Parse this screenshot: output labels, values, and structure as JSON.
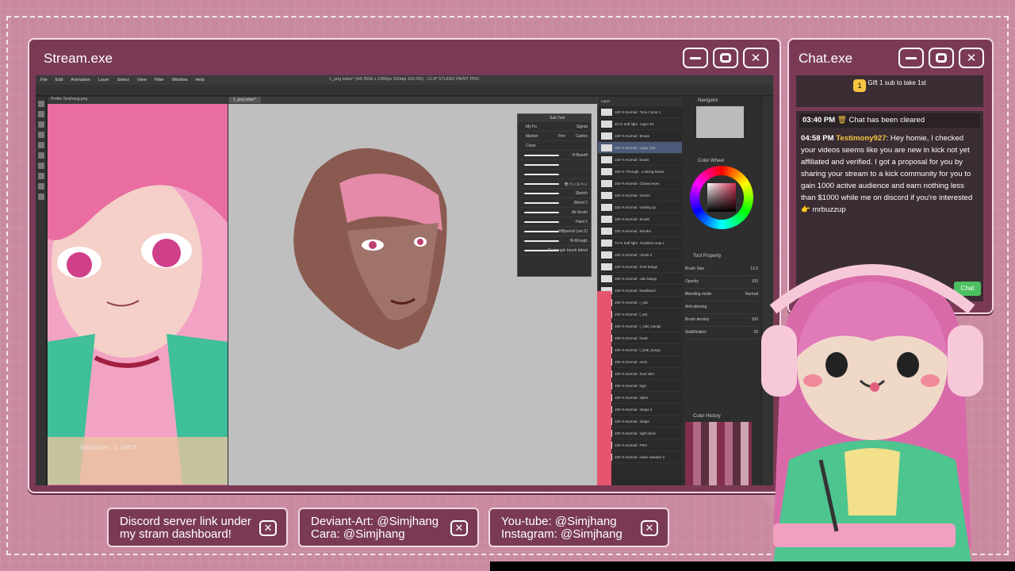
{
  "stream_window": {
    "title": "Stream.exe",
    "buttons": [
      "minimize",
      "maximize",
      "close"
    ]
  },
  "chat_window": {
    "title": "Chat.exe",
    "buttons": [
      "minimize",
      "maximize",
      "close"
    ]
  },
  "app": {
    "title": "1_png tuber* (A4 3508 x 2480px 300dpi 150.0%) - CLIP STUDIO PAINT PRO",
    "menu": [
      "File",
      "Edit",
      "Animation",
      "Layer",
      "Select",
      "View",
      "Filter",
      "Window",
      "Help"
    ],
    "ref_tab": "Profile Simjhang.png",
    "canvas_tab": "1_png tuber*",
    "ref_caption": "Ständchen, S. 560 ff",
    "subtool": {
      "header": "Sub Tool",
      "tabs": [
        "My Fo",
        "Signat"
      ],
      "tabs2": [
        "Marker",
        "Pen",
        "Cartoo"
      ],
      "group": "Close",
      "brushes": [
        "H-Baseft",
        "",
        "",
        "",
        "筆ペンスペン",
        "Sketch",
        "Blend 2",
        "Air brush",
        "Hard 2",
        "HiBpencil (ver.2)",
        "Hi-Brough",
        "Rectangle brush blend"
      ]
    },
    "layers": [
      {
        "pct": "100 % Normal",
        "name": "Tone Curve 1"
      },
      {
        "pct": "33 % Soft light",
        "name": "Layer 51"
      },
      {
        "pct": "100 % Normal",
        "name": "Brows"
      },
      {
        "pct": "100 % Normal",
        "name": "Layer 103"
      },
      {
        "pct": "100 % Normal",
        "name": "brows"
      },
      {
        "pct": "100 % Through",
        "name": "Looking Down"
      },
      {
        "pct": "100 % Normal",
        "name": "Closed eyes"
      },
      {
        "pct": "100 % Normal",
        "name": "screen"
      },
      {
        "pct": "100 % Normal",
        "name": "looking up"
      },
      {
        "pct": "100 % Normal",
        "name": "Mouth"
      },
      {
        "pct": "100 % Normal",
        "name": "Render"
      },
      {
        "pct": "74 % Soft light",
        "name": "Gradient map 1"
      },
      {
        "pct": "100 % Normal",
        "name": "cheek 2"
      },
      {
        "pct": "100 % Normal",
        "name": "front bangs"
      },
      {
        "pct": "100 % Normal",
        "name": "side bangs"
      },
      {
        "pct": "100 % Normal",
        "name": "headband"
      },
      {
        "pct": "100 % Normal",
        "name": "r_ear"
      },
      {
        "pct": "100 % Normal",
        "name": "l_ear"
      },
      {
        "pct": "100 % Normal",
        "name": "r_side_bangs"
      },
      {
        "pct": "100 % Normal",
        "name": "head"
      },
      {
        "pct": "100 % Normal",
        "name": "l_side_bangs"
      },
      {
        "pct": "100 % Normal",
        "name": "neck"
      },
      {
        "pct": "100 % Normal",
        "name": "front skirt"
      },
      {
        "pct": "100 % Normal",
        "name": "legs"
      },
      {
        "pct": "100 % Normal",
        "name": "sailet"
      },
      {
        "pct": "100 % Normal",
        "name": "straps 2"
      },
      {
        "pct": "100 % Normal",
        "name": "straps"
      },
      {
        "pct": "100 % Normal",
        "name": "right hand"
      },
      {
        "pct": "100 % Normal",
        "name": "PEN"
      },
      {
        "pct": "100 % Normal",
        "name": "lower sweater 2"
      }
    ],
    "tool_property": {
      "brush_size": "Brush Size",
      "brush_size_val": "12.0",
      "opacity": "Opacity",
      "opacity_val": "100",
      "blending": "Blending mode",
      "blending_val": "Normal",
      "antialias": "Anti-aliasing",
      "density": "Brush density",
      "density_val": "100",
      "stabilization": "Stabilization",
      "stabilization_val": "20"
    },
    "panels": {
      "navigator": "Navigator",
      "color_wheel": "Color Wheel",
      "tool_property": "Tool Property",
      "color_history": "Color History",
      "layer": "Layer"
    }
  },
  "chat": {
    "pin": "Gift 1 sub to take 1st",
    "pin_count": "1",
    "system": {
      "time": "03:40 PM",
      "text": "Chat has been cleared"
    },
    "message": {
      "time": "04:58 PM",
      "user": "Testimony927",
      "text": ": Hey homie, I checked your videos seems like you are new in kick not yet affiliated and verified. I got a proposal for you by sharing your stream to a kick community for you to gain 1000 active audience and earn nothing less than $1000 while me on discord if you're interested 👉 mrbuzzup"
    },
    "send_label": "Chat"
  },
  "links": [
    {
      "line1": "Discord server link under",
      "line2": "my stram dashboard!"
    },
    {
      "line1": "Deviant-Art: @Simjhang",
      "line2": "Cara: @Simjhang"
    },
    {
      "line1": "You-tube: @Simjhang",
      "line2": "Instagram: @Simjhang"
    }
  ],
  "colors": {
    "window": "#7a3a55",
    "background": "#c98aa0",
    "accent": "#f3d8e3",
    "username": "#f5c542"
  }
}
